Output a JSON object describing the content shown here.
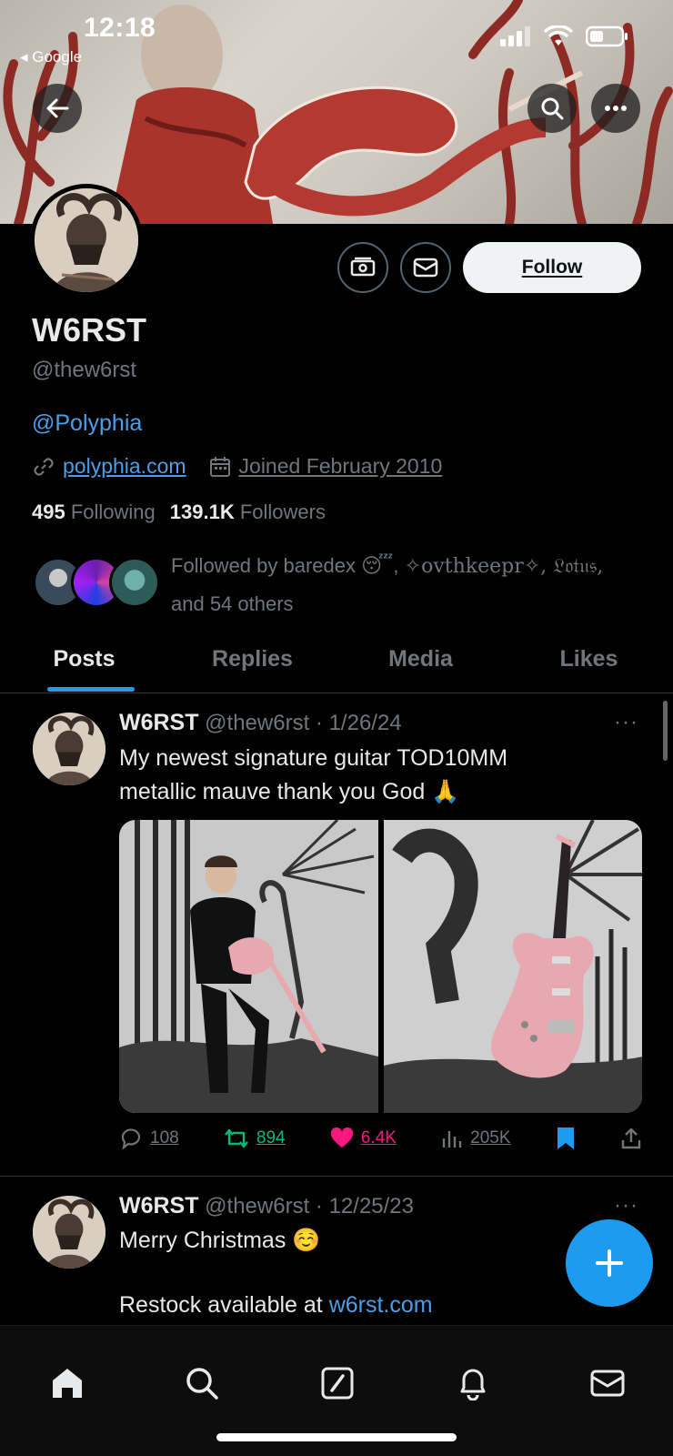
{
  "status_bar": {
    "time": "12:18",
    "back_label": "◂ Google"
  },
  "profile": {
    "name": "W6RST",
    "handle": "@thew6rst",
    "bio": "@Polyphia",
    "website": "polyphia.com",
    "joined": "Joined February 2010",
    "following_count": "495",
    "following_label": "Following",
    "followers_count": "139.1K",
    "followers_label": "Followers",
    "followed_by_prefix": "Followed by baredex 😴, ",
    "followed_by_names": "✧ovthkeepr✧, 𝔏𝔬𝔱𝔲𝔰,",
    "followed_by_suffix": "and 54 others",
    "follow_label": "Follow"
  },
  "tabs": [
    {
      "label": "Posts",
      "active": true
    },
    {
      "label": "Replies",
      "active": false
    },
    {
      "label": "Media",
      "active": false
    },
    {
      "label": "Likes",
      "active": false
    }
  ],
  "posts": [
    {
      "name": "W6RST",
      "handle": "@thew6rst",
      "date": "1/26/24",
      "text_line1": "My newest signature guitar TOD10MM",
      "text_line2": "metallic mauve thank you God 🙏",
      "replies": "108",
      "reposts": "894",
      "likes": "6.4K",
      "views": "205K"
    },
    {
      "name": "W6RST",
      "handle": "@thew6rst",
      "date": "12/25/23",
      "text_line1": "Merry Christmas ☺️",
      "text_line2_prefix": "Restock available at ",
      "text_line2_link": "w6rst.com"
    }
  ],
  "colors": {
    "accent": "#1d9bf0",
    "repost": "#00ba7c",
    "like": "#f91880",
    "link": "#4a9fe8",
    "muted": "#71767b"
  }
}
